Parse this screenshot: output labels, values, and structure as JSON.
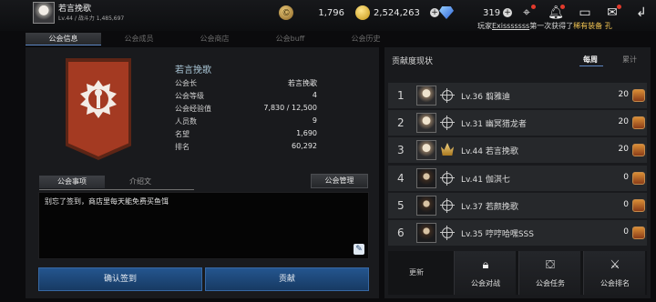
{
  "player": {
    "name": "若言挽歌",
    "stats": "Lv.44 / 战斗力 1,485,697"
  },
  "currency": {
    "coin": "1,796",
    "gold": "2,524,263",
    "gem": "319"
  },
  "ticker": {
    "prefix": "玩家",
    "name": "Exisssssss",
    "middle": "第一次获得了",
    "item": "稀有装备 孔"
  },
  "tabs": [
    "公会信息",
    "公会成员",
    "公会商店",
    "公会buff",
    "公会历史"
  ],
  "guild": {
    "name": "若言挽歌",
    "rows": [
      {
        "k": "公会长",
        "v": "若言挽歌"
      },
      {
        "k": "公会等级",
        "v": "4"
      },
      {
        "k": "公会经验值",
        "v": "7,830 / 12,500"
      },
      {
        "k": "人员数",
        "v": "9"
      },
      {
        "k": "名望",
        "v": "1,690"
      },
      {
        "k": "排名",
        "v": "60,292"
      }
    ]
  },
  "notice": {
    "tab_notice": "公会事项",
    "tab_intro": "介绍文",
    "manage_label": "公会管理",
    "text": "别忘了签到，商店里每天能免费买鱼饵"
  },
  "buttons": {
    "checkin": "确认签到",
    "contribute": "贡献"
  },
  "ranking": {
    "title": "贡献度现状",
    "weekly": "每周",
    "total": "累计",
    "rows": [
      {
        "rank": "1",
        "label": "Lv.36 翦雅迪",
        "score": "20"
      },
      {
        "rank": "2",
        "label": "Lv.31 幽冥猎龙者",
        "score": "20"
      },
      {
        "rank": "3",
        "label": "Lv.44 若言挽歌",
        "score": "20"
      },
      {
        "rank": "4",
        "label": "Lv.41 伽淇七",
        "score": "0"
      },
      {
        "rank": "5",
        "label": "Lv.37 若颜挽歌",
        "score": "0"
      },
      {
        "rank": "6",
        "label": "Lv.35 哼哼哈嘿SSS",
        "score": "0"
      }
    ]
  },
  "bottom": {
    "refresh": "更新",
    "war": "公会对战",
    "quest": "公会任务",
    "rank": "公会排名"
  }
}
